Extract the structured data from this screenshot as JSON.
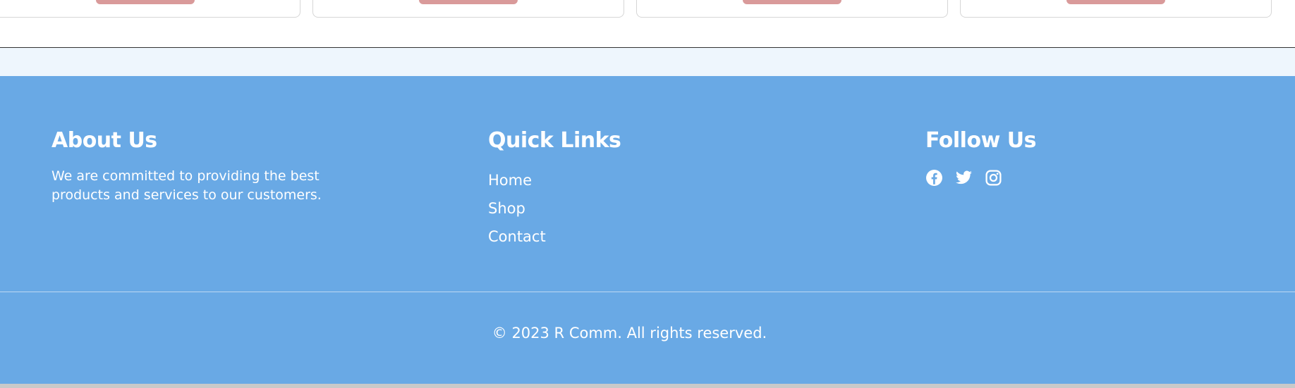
{
  "colors": {
    "footer_bg": "#69a9e5",
    "pale_band": "#eef6fd",
    "card_button": "#d99a9a",
    "bottom_strip": "#c9c9c9"
  },
  "footer": {
    "about": {
      "title": "About Us",
      "text": "We are committed to providing the best products and services to our customers."
    },
    "quick_links": {
      "title": "Quick Links",
      "items": [
        "Home",
        "Shop",
        "Contact"
      ]
    },
    "follow": {
      "title": "Follow Us",
      "icons": [
        "facebook-icon",
        "twitter-icon",
        "instagram-icon"
      ]
    },
    "copyright": "© 2023 R Comm. All rights reserved."
  }
}
